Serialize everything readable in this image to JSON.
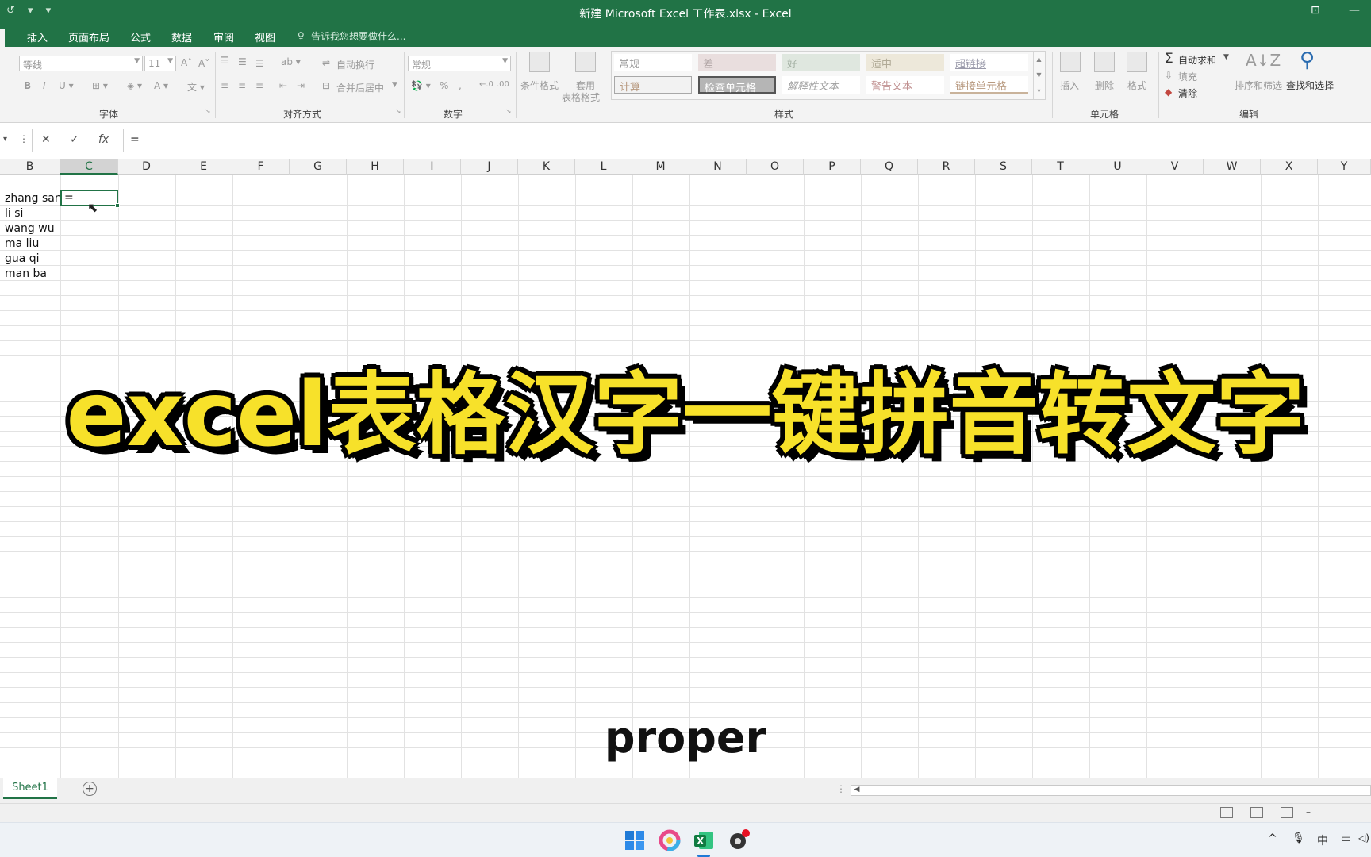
{
  "window": {
    "title": "新建 Microsoft Excel 工作表.xlsx - Excel",
    "qat": "↺ ▾ ▾"
  },
  "tabs": [
    "插入",
    "页面布局",
    "公式",
    "数据",
    "审阅",
    "视图"
  ],
  "tell_me": "告诉我您想要做什么...",
  "ribbon": {
    "font": {
      "name": "等线",
      "size": "11",
      "group_label": "字体"
    },
    "align": {
      "wrap": "自动换行",
      "merge": "合并后居中",
      "group_label": "对齐方式"
    },
    "number": {
      "format": "常规",
      "group_label": "数字"
    },
    "styles": {
      "cond_format": "条件格式",
      "table_format_1": "套用",
      "table_format_2": "表格格式",
      "cells": [
        {
          "label": "常规",
          "color": "#9a9a9a"
        },
        {
          "label": "差",
          "color": "#b0a4a4"
        },
        {
          "label": "好",
          "color": "#a3b0a3"
        },
        {
          "label": "适中",
          "color": "#b0aa96"
        },
        {
          "label": "超链接",
          "color": "#9a9aaa"
        },
        {
          "label": "计算",
          "color": "#b89a80"
        },
        {
          "label": "检查单元格",
          "color": "#ffffff"
        },
        {
          "label": "解释性文本",
          "color": "#a0a0a0"
        },
        {
          "label": "警告文本",
          "color": "#c09090"
        },
        {
          "label": "链接单元格",
          "color": "#b89a80"
        }
      ],
      "group_label": "样式"
    },
    "cells": {
      "insert": "插入",
      "delete": "删除",
      "format": "格式",
      "group_label": "单元格"
    },
    "editing": {
      "autosum": "自动求和",
      "fill": "填充",
      "clear": "清除",
      "sort": "排序和筛选",
      "find": "查找和选择",
      "group_label": "编辑"
    }
  },
  "formula_bar": {
    "cancel": "✕",
    "enter": "✓",
    "fx": "fx",
    "content": "="
  },
  "columns": [
    "B",
    "C",
    "D",
    "E",
    "F",
    "G",
    "H",
    "I",
    "J",
    "K",
    "L",
    "M",
    "N",
    "O",
    "P",
    "Q",
    "R",
    "S",
    "T",
    "U",
    "V",
    "W",
    "X",
    "Y"
  ],
  "selected_column": "C",
  "cells_b": [
    "zhang san",
    "li si",
    "wang wu",
    "ma liu",
    "gua qi",
    "man ba"
  ],
  "active_cell_value": "=",
  "overlay": {
    "banner": "excel表格汉字一键拼音转文字",
    "caption": "proper"
  },
  "sheet": {
    "tab": "Sheet1",
    "add": "+"
  },
  "tray": {
    "chevron": "^",
    "mic": "🎙",
    "ime": "中",
    "network": "▭",
    "volume": "◁)"
  },
  "colors": {
    "excel_green": "#217346",
    "banner_yellow": "#f7e12a"
  }
}
